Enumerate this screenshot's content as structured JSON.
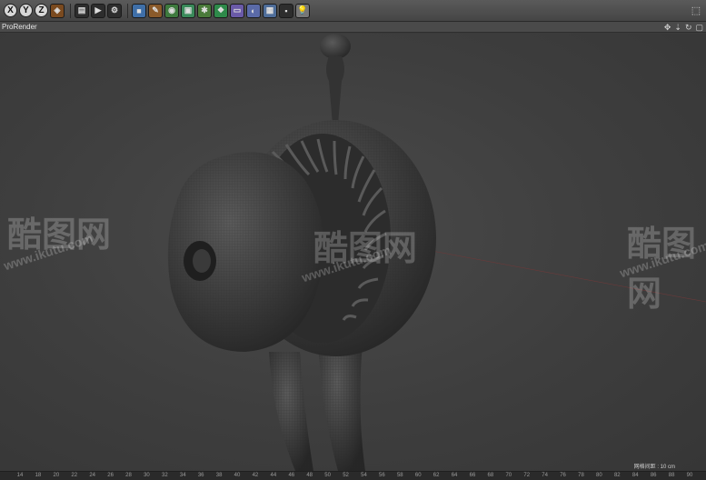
{
  "toolbar": {
    "axes": [
      "X",
      "Y",
      "Z"
    ],
    "icons": [
      "world-coord-icon",
      "render-region-icon",
      "render-view-icon",
      "render-settings-icon",
      "cube-icon",
      "pen-icon",
      "subdivide-icon",
      "array-icon",
      "bend-deformer-icon",
      "atom-array-icon",
      "floor-icon",
      "scene-camera-icon",
      "sky-icon",
      "lamp-icon"
    ]
  },
  "viewport": {
    "title": "ProRender",
    "grid_spacing_label": "网格间距 : 10 cm"
  },
  "ruler": {
    "ticks": [
      "14",
      "18",
      "20",
      "22",
      "24",
      "26",
      "28",
      "30",
      "32",
      "34",
      "36",
      "38",
      "40",
      "42",
      "44",
      "46",
      "48",
      "50",
      "52",
      "54",
      "56",
      "58",
      "60",
      "62",
      "64",
      "66",
      "68",
      "70",
      "72",
      "74",
      "76",
      "78",
      "80",
      "82",
      "84",
      "86",
      "88",
      "90"
    ]
  },
  "watermark": {
    "logo_text": "酷图网",
    "url": "www.ikutu.com"
  },
  "colors": {
    "toolbar_bg": "#4f4f4f",
    "viewport_bg": "#3e3e3e",
    "model": "#3a3a3a"
  }
}
